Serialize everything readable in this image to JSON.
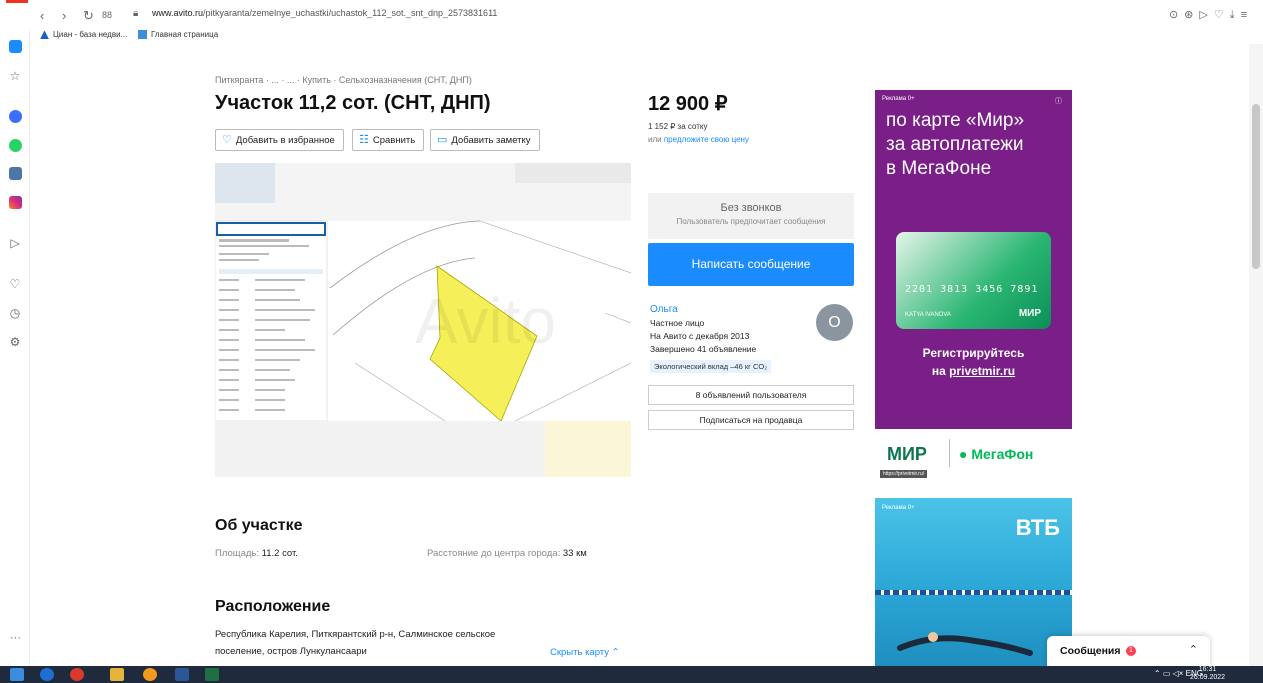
{
  "browser": {
    "url_domain": "www.avito.ru",
    "url_path": "/pitkyaranta/zemelnye_uchastki/uchastok_112_sot._snt_dnp_2573831611",
    "bookmarks": [
      "Циан - база недви...",
      "Главная страница"
    ],
    "tabs_count_label": "88"
  },
  "breadcrumbs": "Питкяранта · ... · ... · Купить · Сельхозназначения (СНТ, ДНП)",
  "listing": {
    "title": "Участок 11,2 сот. (СНТ, ДНП)",
    "actions": [
      "Добавить в избранное",
      "Сравнить",
      "Добавить заметку"
    ],
    "watermark": "Avito"
  },
  "price": {
    "value": "12 900 ₽",
    "per_unit": "1 152 ₽ за сотку",
    "offer_prefix": "или",
    "offer_link": "предложите свою цену"
  },
  "contact": {
    "no_calls_title": "Без звонков",
    "no_calls_sub": "Пользователь предпочитает сообщения",
    "message_button": "Написать сообщение"
  },
  "seller": {
    "name": "Ольга",
    "type": "Частное лицо",
    "since": "На Авито с декабря 2013",
    "completed": "Завершено 41 объявление",
    "eco": "Экологический вклад –46 кг CO₂",
    "avatar_letter": "О",
    "listings_button": "8 объявлений пользователя",
    "subscribe_button": "Подписаться на продавца"
  },
  "about": {
    "heading": "Об участке",
    "area_label": "Площадь:",
    "area_value": "11.2 сот.",
    "distance_label": "Расстояние до центра города:",
    "distance_value": "33 км"
  },
  "location": {
    "heading": "Расположение",
    "address_line1": "Республика Карелия, Питкярантский р-н, Салминское сельское",
    "address_line2": "поселение, остров Лункулансаари",
    "hide_map": "Скрыть карту"
  },
  "ad1": {
    "label": "Реклама  0+",
    "headline": [
      "по карте «Мир»",
      "за автоплатежи",
      "в МегаФоне"
    ],
    "card_number": "2201 3813 3456 7891",
    "card_name": "KATYA IVANOVA",
    "card_brand": "МИР",
    "cta_line1": "Регистрируйтесь",
    "cta_prefix": "на ",
    "cta_link": "privetmir.ru",
    "brand_mir": "МИР",
    "brand_mega": "МегаФон",
    "url": "https://privetmir.ru/"
  },
  "ad2": {
    "label": "Реклама  0+",
    "brand": "ВТБ"
  },
  "messages_widget": {
    "label": "Сообщения",
    "badge": "1"
  },
  "taskbar": {
    "lang": "ENG",
    "time": "16:31",
    "date": "26.09.2022"
  },
  "colors": {
    "accent": "#1a8cff",
    "plot": "#f5f05a",
    "ad_purple": "#7a1f87",
    "megafon_green": "#00b956"
  }
}
